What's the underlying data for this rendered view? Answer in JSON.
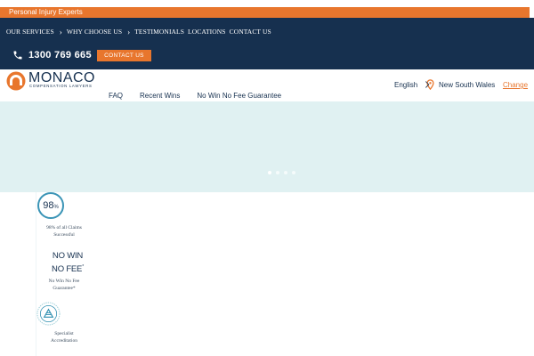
{
  "topbar": {
    "text": "Personal Injury Experts"
  },
  "nav": {
    "links": [
      "OUR SERVICES",
      "WHY CHOOSE US",
      "TESTIMONIALS",
      "LOCATIONS",
      "CONTACT US"
    ],
    "phone": "1300 769 665",
    "contact_button": "CONTACT US"
  },
  "header": {
    "logo_word": "MONACO",
    "logo_sub": "COMPENSATION LAWYERS",
    "menu": [
      "FAQ",
      "Recent Wins",
      "No Win No Fee Guarantee"
    ],
    "language": "English",
    "region": "New South Wales",
    "change_label": "Change"
  },
  "hero": {
    "slide_count": 4,
    "active_slide": 1
  },
  "features": {
    "stat_value": "98",
    "stat_unit": "%",
    "stat_caption": "98% of all Claims Successful",
    "nowin_line1": "NO WIN",
    "nowin_line2": "NO FEE",
    "nowin_mark": "*",
    "nowin_caption": "No Win No Fee Guarantee*",
    "badge_caption": "Specialist Accreditation"
  },
  "colors": {
    "navy": "#16304f",
    "orange": "#e8762d",
    "hero_bg": "#e0f1f2",
    "stat_ring": "#3a94b6"
  }
}
